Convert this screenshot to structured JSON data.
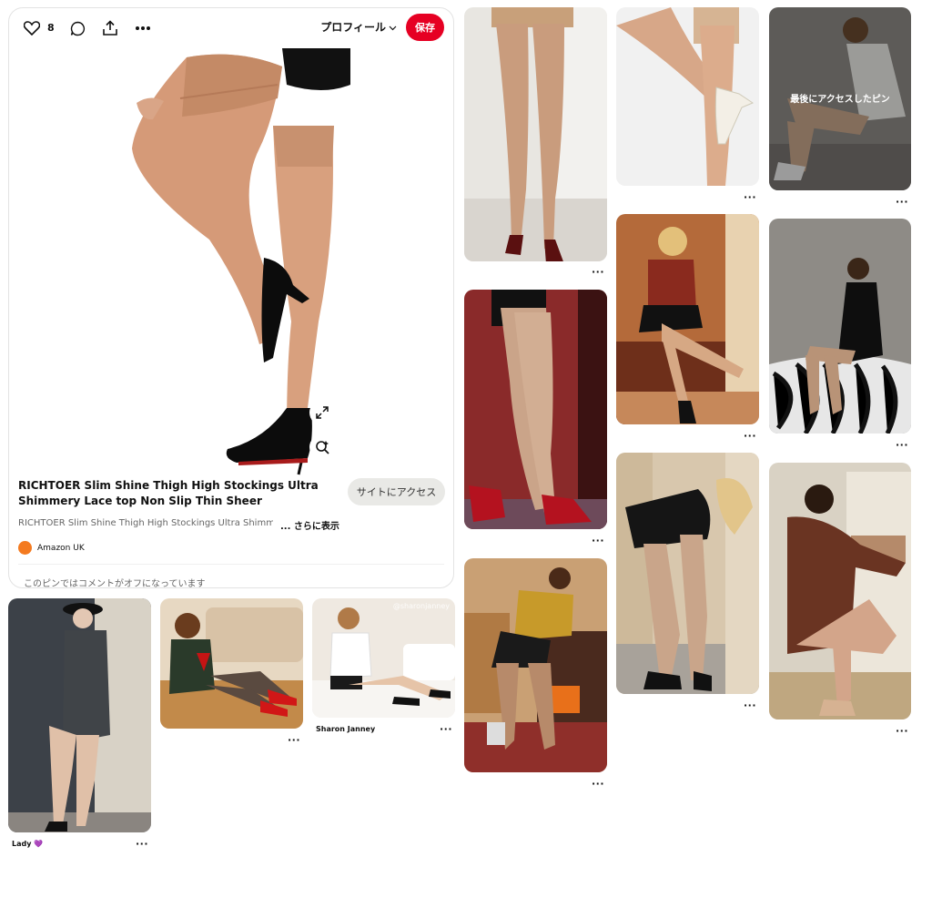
{
  "toolbar": {
    "like_count": "8",
    "profile_label": "プロフィール",
    "save_label": "保存"
  },
  "main_pin": {
    "title": "RICHTOER Slim Shine Thigh High Stockings Ultra Shimmery Lace top Non Slip Thin Sheer",
    "description": "RICHTOER Slim Shine Thigh High Stockings Ultra Shimmery Lace top Non Slip Thin Sheer",
    "more_label": "... さらに表示",
    "visit_label": "サイトにアクセス",
    "source_name": "Amazon UK",
    "comments_off": "このピンではコメントがオフになっています"
  },
  "pins": [
    {
      "caption": ""
    },
    {
      "caption": ""
    },
    {
      "caption": ""
    },
    {
      "caption": "",
      "overlay": "最後にアクセスしたピン"
    },
    {
      "caption": ""
    },
    {
      "caption": ""
    },
    {
      "caption": ""
    },
    {
      "caption": ""
    },
    {
      "caption": ""
    },
    {
      "caption": "Lady 💜"
    },
    {
      "caption": ""
    },
    {
      "caption": "Sharon Janney",
      "watermark": "@sharonjanney"
    }
  ],
  "more_dots": "···",
  "colors": {
    "brand_red": "#e60023",
    "source_orange": "#f47a1f"
  },
  "icons": [
    "heart-icon",
    "comment-icon",
    "share-icon",
    "more-icon",
    "chevron-down-icon",
    "expand-icon",
    "visual-search-icon"
  ]
}
